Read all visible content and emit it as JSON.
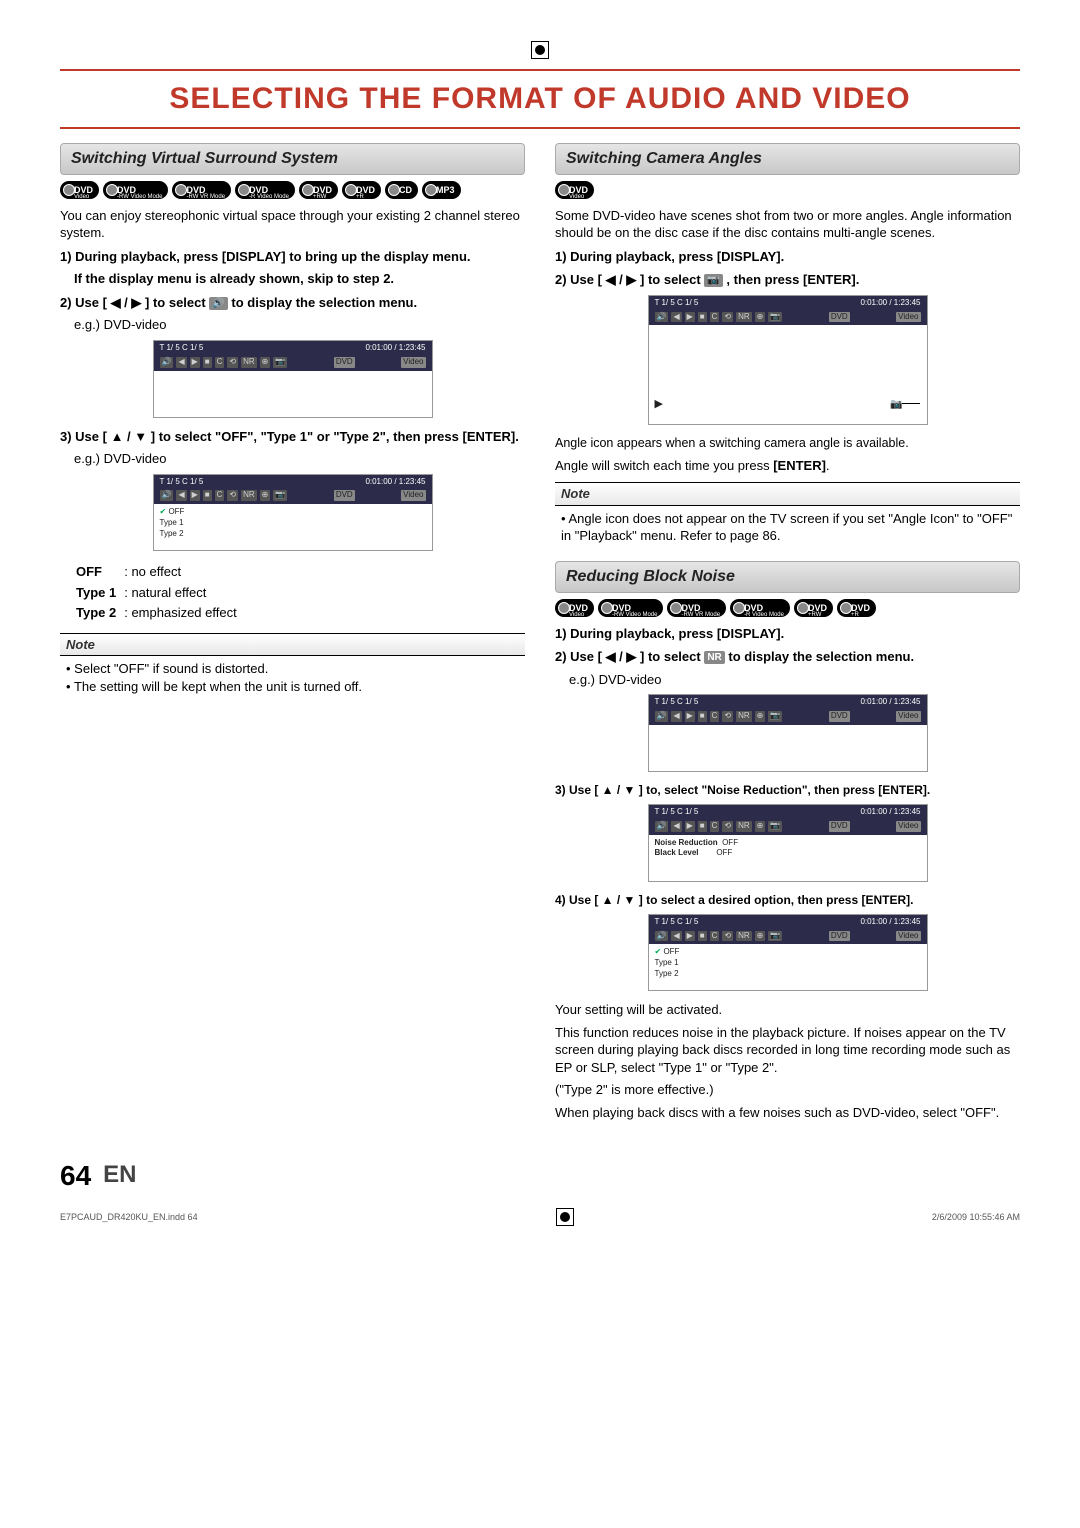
{
  "page_title": "SELECTING THE FORMAT OF AUDIO AND VIDEO",
  "page_number": "64",
  "page_lang": "EN",
  "printer_file": "E7PCAUD_DR420KU_EN.indd   64",
  "printer_date": "2/6/2009   10:55:46 AM",
  "osd": {
    "top_left": "T   1/  5   C   1/  5",
    "top_right": "0:01:00  /  1:23:45",
    "badge1": "DVD",
    "badge2": "Video"
  },
  "left": {
    "section_title": "Switching Virtual Surround System",
    "formats": [
      "DVD Video",
      "DVD -RW Video Mode",
      "DVD -RW VR Mode",
      "DVD -R Video Mode",
      "DVD +RW",
      "DVD +R",
      "CD",
      "MP3"
    ],
    "intro": "You can enjoy stereophonic virtual space through your existing 2 channel stereo system.",
    "step1a": "1) During playback, press [DISPLAY] to bring up the display menu.",
    "step1b": "If the display menu is already shown, skip to step 2.",
    "step2": "2) Use [ ◀ / ▶ ] to select",
    "step2_tail": "to display the selection menu.",
    "eg": "e.g.) DVD-video",
    "step3": "3) Use [ ▲ / ▼ ] to select \"OFF\", \"Type 1\" or \"Type 2\", then press [ENTER].",
    "osd2_lines": [
      "OFF",
      "Type 1",
      "Type 2"
    ],
    "opts": [
      {
        "k": "OFF",
        "v": ": no effect"
      },
      {
        "k": "Type 1",
        "v": ": natural effect"
      },
      {
        "k": "Type 2",
        "v": ": emphasized effect"
      }
    ],
    "note_hdr": "Note",
    "note_items": [
      "Select \"OFF\" if sound is distorted.",
      "The setting will be kept when the unit is turned off."
    ]
  },
  "rightA": {
    "section_title": "Switching Camera Angles",
    "formats": [
      "DVD Video"
    ],
    "intro": "Some DVD-video have scenes shot from two or more angles. Angle information should be on the disc case if the disc contains multi-angle scenes.",
    "step1": "1) During playback, press [DISPLAY].",
    "step2": "2) Use [ ◀ / ▶ ] to select",
    "step2_tail": ", then press [ENTER].",
    "play_hint": "▶",
    "after1": "Angle icon appears when a switching camera angle is available.",
    "after2_pre": "Angle will switch each time you press ",
    "after2_b": "[ENTER]",
    "after2_post": ".",
    "note_hdr": "Note",
    "note_items": [
      "Angle icon does not appear on the TV screen if you set \"Angle Icon\" to \"OFF\" in \"Playback\" menu. Refer to page 86."
    ]
  },
  "rightB": {
    "section_title": "Reducing Block Noise",
    "formats": [
      "DVD Video",
      "DVD -RW Video Mode",
      "DVD -RW VR Mode",
      "DVD -R Video Mode",
      "DVD +RW",
      "DVD +R"
    ],
    "step1": "1) During playback, press [DISPLAY].",
    "step2": "2) Use [ ◀ / ▶ ] to select",
    "step2_tail": "to display the selection menu.",
    "nr_badge": "NR",
    "eg": "e.g.) DVD-video",
    "step3": "3) Use [ ▲ / ▼ ] to, select \"Noise Reduction\", then press [ENTER].",
    "osd_nr": {
      "l1": "Noise Reduction",
      "v1": "OFF",
      "l2": "Black Level",
      "v2": "OFF"
    },
    "step4": "4) Use [ ▲ / ▼ ] to select a desired option, then press [ENTER].",
    "osd4_lines": [
      "OFF",
      "Type 1",
      "Type 2"
    ],
    "tail1": "Your setting will be activated.",
    "tail2": "This function reduces noise in the playback picture. If noises appear on the TV screen during playing back discs recorded in long time recording mode such as EP or SLP, select \"Type 1\" or \"Type 2\".",
    "tail3": "(\"Type 2\" is more effective.)",
    "tail4": "When playing back discs with a few noises such as DVD-video, select \"OFF\"."
  }
}
